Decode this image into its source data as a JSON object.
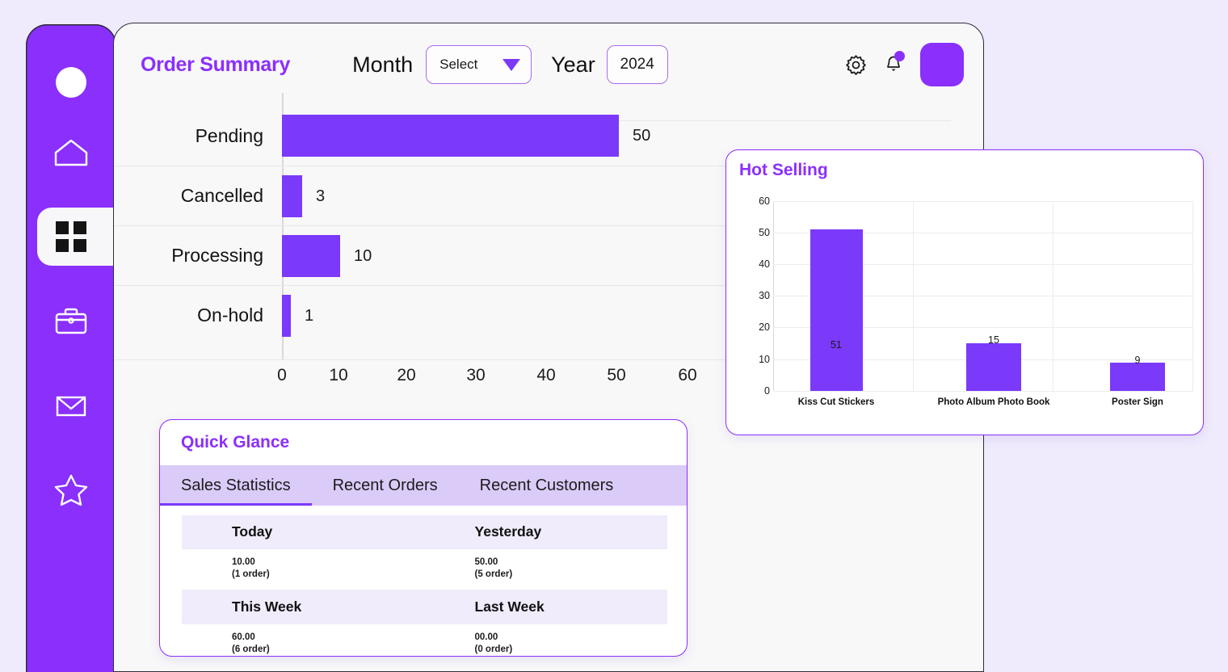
{
  "sidebar": {
    "logo_icon": "circle-logo-icon",
    "items": [
      {
        "icon": "home-icon",
        "name": "sidebar-item-home",
        "active": false
      },
      {
        "icon": "grid-icon",
        "name": "sidebar-item-dashboard",
        "active": true
      },
      {
        "icon": "briefcase-icon",
        "name": "sidebar-item-orders",
        "active": false
      },
      {
        "icon": "envelope-icon",
        "name": "sidebar-item-messages",
        "active": false
      },
      {
        "icon": "star-icon",
        "name": "sidebar-item-favorites",
        "active": false
      }
    ]
  },
  "header": {
    "title": "Order Summary",
    "month_label": "Month",
    "month_value": "Select",
    "year_label": "Year",
    "year_value": "2024",
    "settings_icon": "gear-icon",
    "notification_icon": "bell-icon",
    "avatar": "avatar"
  },
  "quick_glance": {
    "title": "Quick Glance",
    "tabs": [
      {
        "label": "Sales Statistics",
        "active": true
      },
      {
        "label": "Recent Orders",
        "active": false
      },
      {
        "label": "Recent Customers",
        "active": false
      }
    ],
    "rows": [
      {
        "headers": [
          "Today",
          "Yesterday"
        ],
        "values": [
          {
            "amount": "10.00",
            "orders": "(1 order)"
          },
          {
            "amount": "50.00",
            "orders": "(5 order)"
          }
        ]
      },
      {
        "headers": [
          "This Week",
          "Last Week"
        ],
        "values": [
          {
            "amount": "60.00",
            "orders": "(6 order)"
          },
          {
            "amount": "00.00",
            "orders": "(0 order)"
          }
        ]
      }
    ]
  },
  "hot_selling": {
    "title": "Hot Selling"
  },
  "colors": {
    "brand_purple": "#8b2ffc",
    "bar_purple": "#7b39fa",
    "page_bg": "#efebfd",
    "card_bg": "#f8f8f9",
    "tab_bg": "#dbcbf8"
  },
  "chart_data": [
    {
      "type": "bar",
      "orientation": "horizontal",
      "id": "order-summary-chart",
      "title": "Order Summary",
      "categories": [
        "Pending",
        "Cancelled",
        "Processing",
        "On-hold"
      ],
      "values": [
        50,
        3,
        10,
        1
      ],
      "data_labels": [
        "50",
        "3",
        "10",
        "1"
      ],
      "xlabel": "",
      "ylabel": "",
      "xlim": [
        0,
        60
      ],
      "xticks": [
        0,
        10,
        20,
        30,
        40,
        50,
        60
      ],
      "xtick_labels": [
        "0",
        "10",
        "20",
        "30",
        "40",
        "50",
        "60"
      ],
      "grid": true,
      "legend": "none",
      "bar_color": "#7b39fa"
    },
    {
      "type": "bar",
      "orientation": "vertical",
      "id": "hot-selling-chart",
      "title": "Hot Selling",
      "categories": [
        "Kiss Cut Stickers",
        "Photo Album Photo Book",
        "Poster Sign"
      ],
      "values": [
        51,
        15,
        9
      ],
      "data_labels": [
        "51",
        "15",
        "9"
      ],
      "xlabel": "",
      "ylabel": "",
      "ylim": [
        0,
        60
      ],
      "yticks": [
        0,
        10,
        20,
        30,
        40,
        50,
        60
      ],
      "ytick_labels": [
        "0",
        "10",
        "20",
        "30",
        "40",
        "50",
        "60"
      ],
      "grid": true,
      "legend": "none",
      "bar_color": "#7b39fa"
    }
  ]
}
